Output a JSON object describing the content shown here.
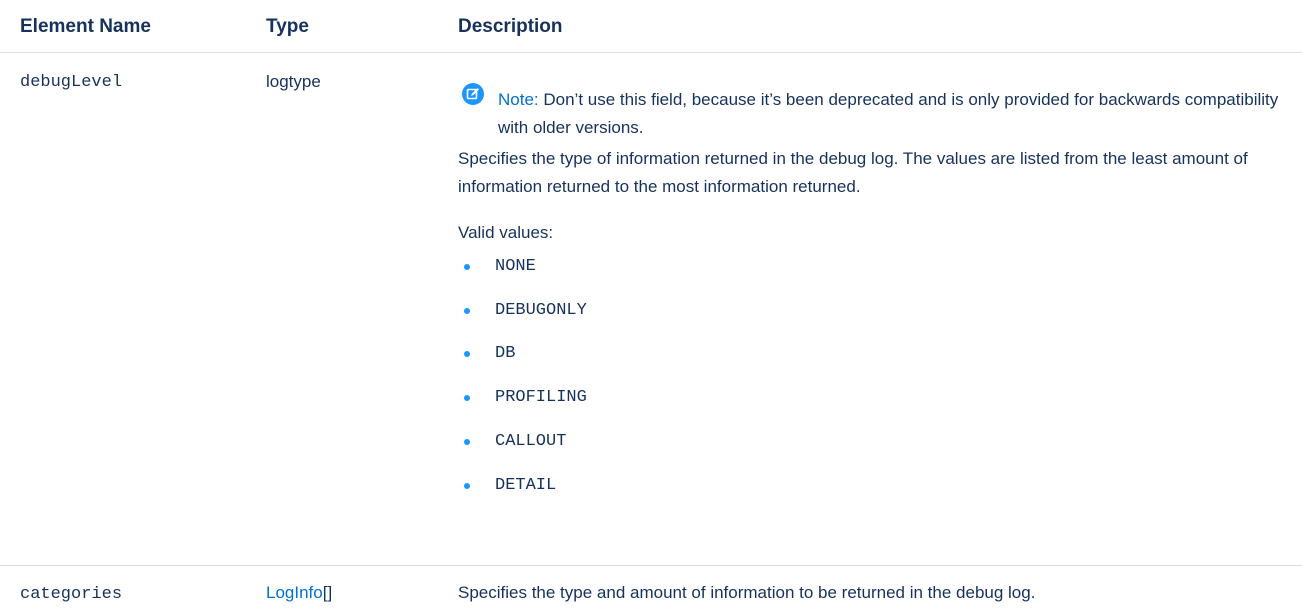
{
  "table": {
    "headers": {
      "name": "Element Name",
      "type": "Type",
      "description": "Description"
    },
    "rows": [
      {
        "name": "debugLevel",
        "type": "logtype",
        "note_label": "Note:",
        "note_text": "Don’t use this field, because it’s been deprecated and is only provided for backwards compatibility with older versions.",
        "description": "Specifies the type of information returned in the debug log. The values are listed from the least amount of information returned to the most information returned.",
        "valid_values_label": "Valid values:",
        "values": [
          "NONE",
          "DEBUGONLY",
          "DB",
          "PROFILING",
          "CALLOUT",
          "DETAIL"
        ]
      },
      {
        "name": "categories",
        "type_link": "LogInfo",
        "type_suffix": "[]",
        "description": "Specifies the type and amount of information to be returned in the debug log."
      }
    ]
  },
  "colors": {
    "text": "#16325c",
    "link": "#0070d2",
    "accent": "#1b96ff",
    "rule": "#d8dde6"
  },
  "icons": {
    "note": "edit-note-icon",
    "bullet": "bullet-icon"
  }
}
